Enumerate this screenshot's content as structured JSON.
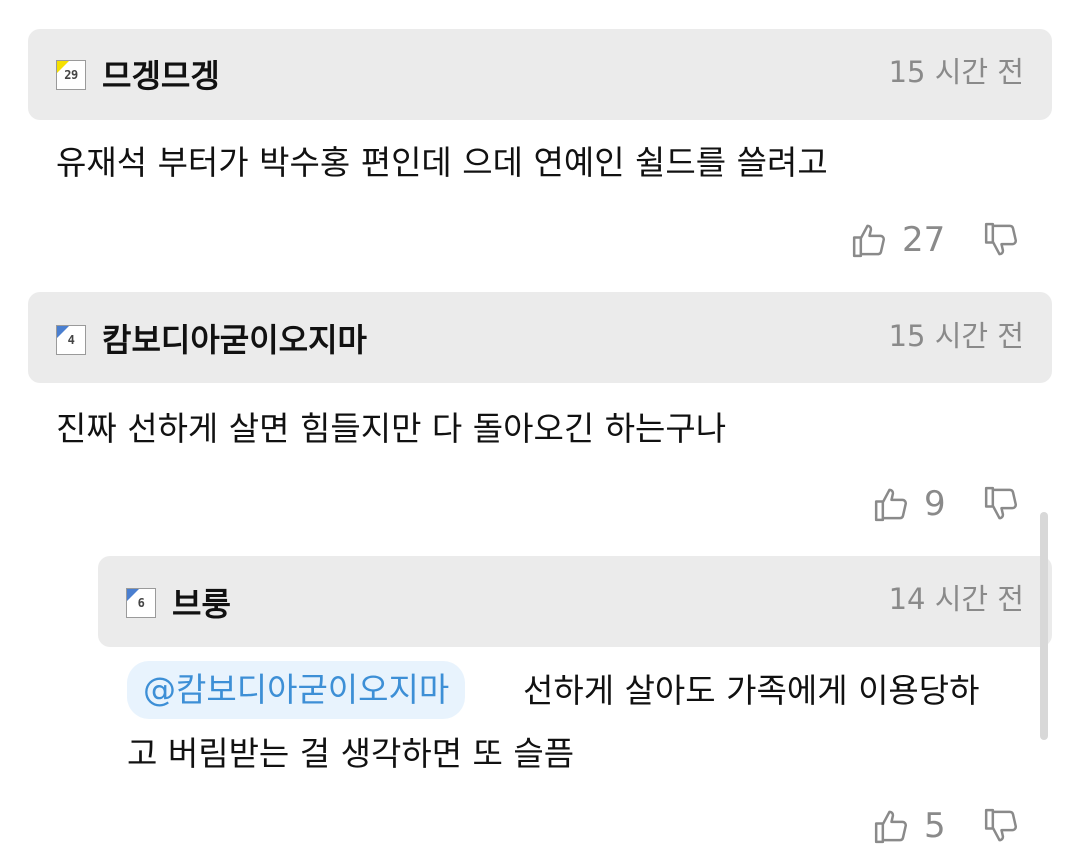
{
  "comments": [
    {
      "nickname": "므겡므겡",
      "level": "29",
      "badge_color": "#f5e000",
      "time": "15 시간 전",
      "text": "유재석 부터가 박수홍 편인데 으데 연예인 쉴드를 쓸려고",
      "likes": "27"
    },
    {
      "nickname": "캄보디아굳이오지마",
      "level": "4",
      "badge_color": "#4a7fd0",
      "time": "15 시간 전",
      "text": "진짜 선하게 살면 힘들지만 다 돌아오긴 하는구나",
      "likes": "9"
    }
  ],
  "reply": {
    "nickname": "브룽",
    "level": "6",
    "badge_color": "#4a7fd0",
    "time": "14 시간 전",
    "mention": "@캄보디아굳이오지마",
    "text_line1": "선하게 살아도 가족에게 이용당하",
    "text_line2": "고 버림받는 걸 생각하면 또 슬픔",
    "likes": "5"
  },
  "icons": {
    "like": "thumbs-up-outline-icon",
    "dislike": "thumbs-down-outline-icon"
  },
  "colors": {
    "header_bg": "#ebebeb",
    "mention_bg": "#e8f3fd",
    "mention_text": "#3d8fd6",
    "meta_gray": "#8a8a8a"
  }
}
